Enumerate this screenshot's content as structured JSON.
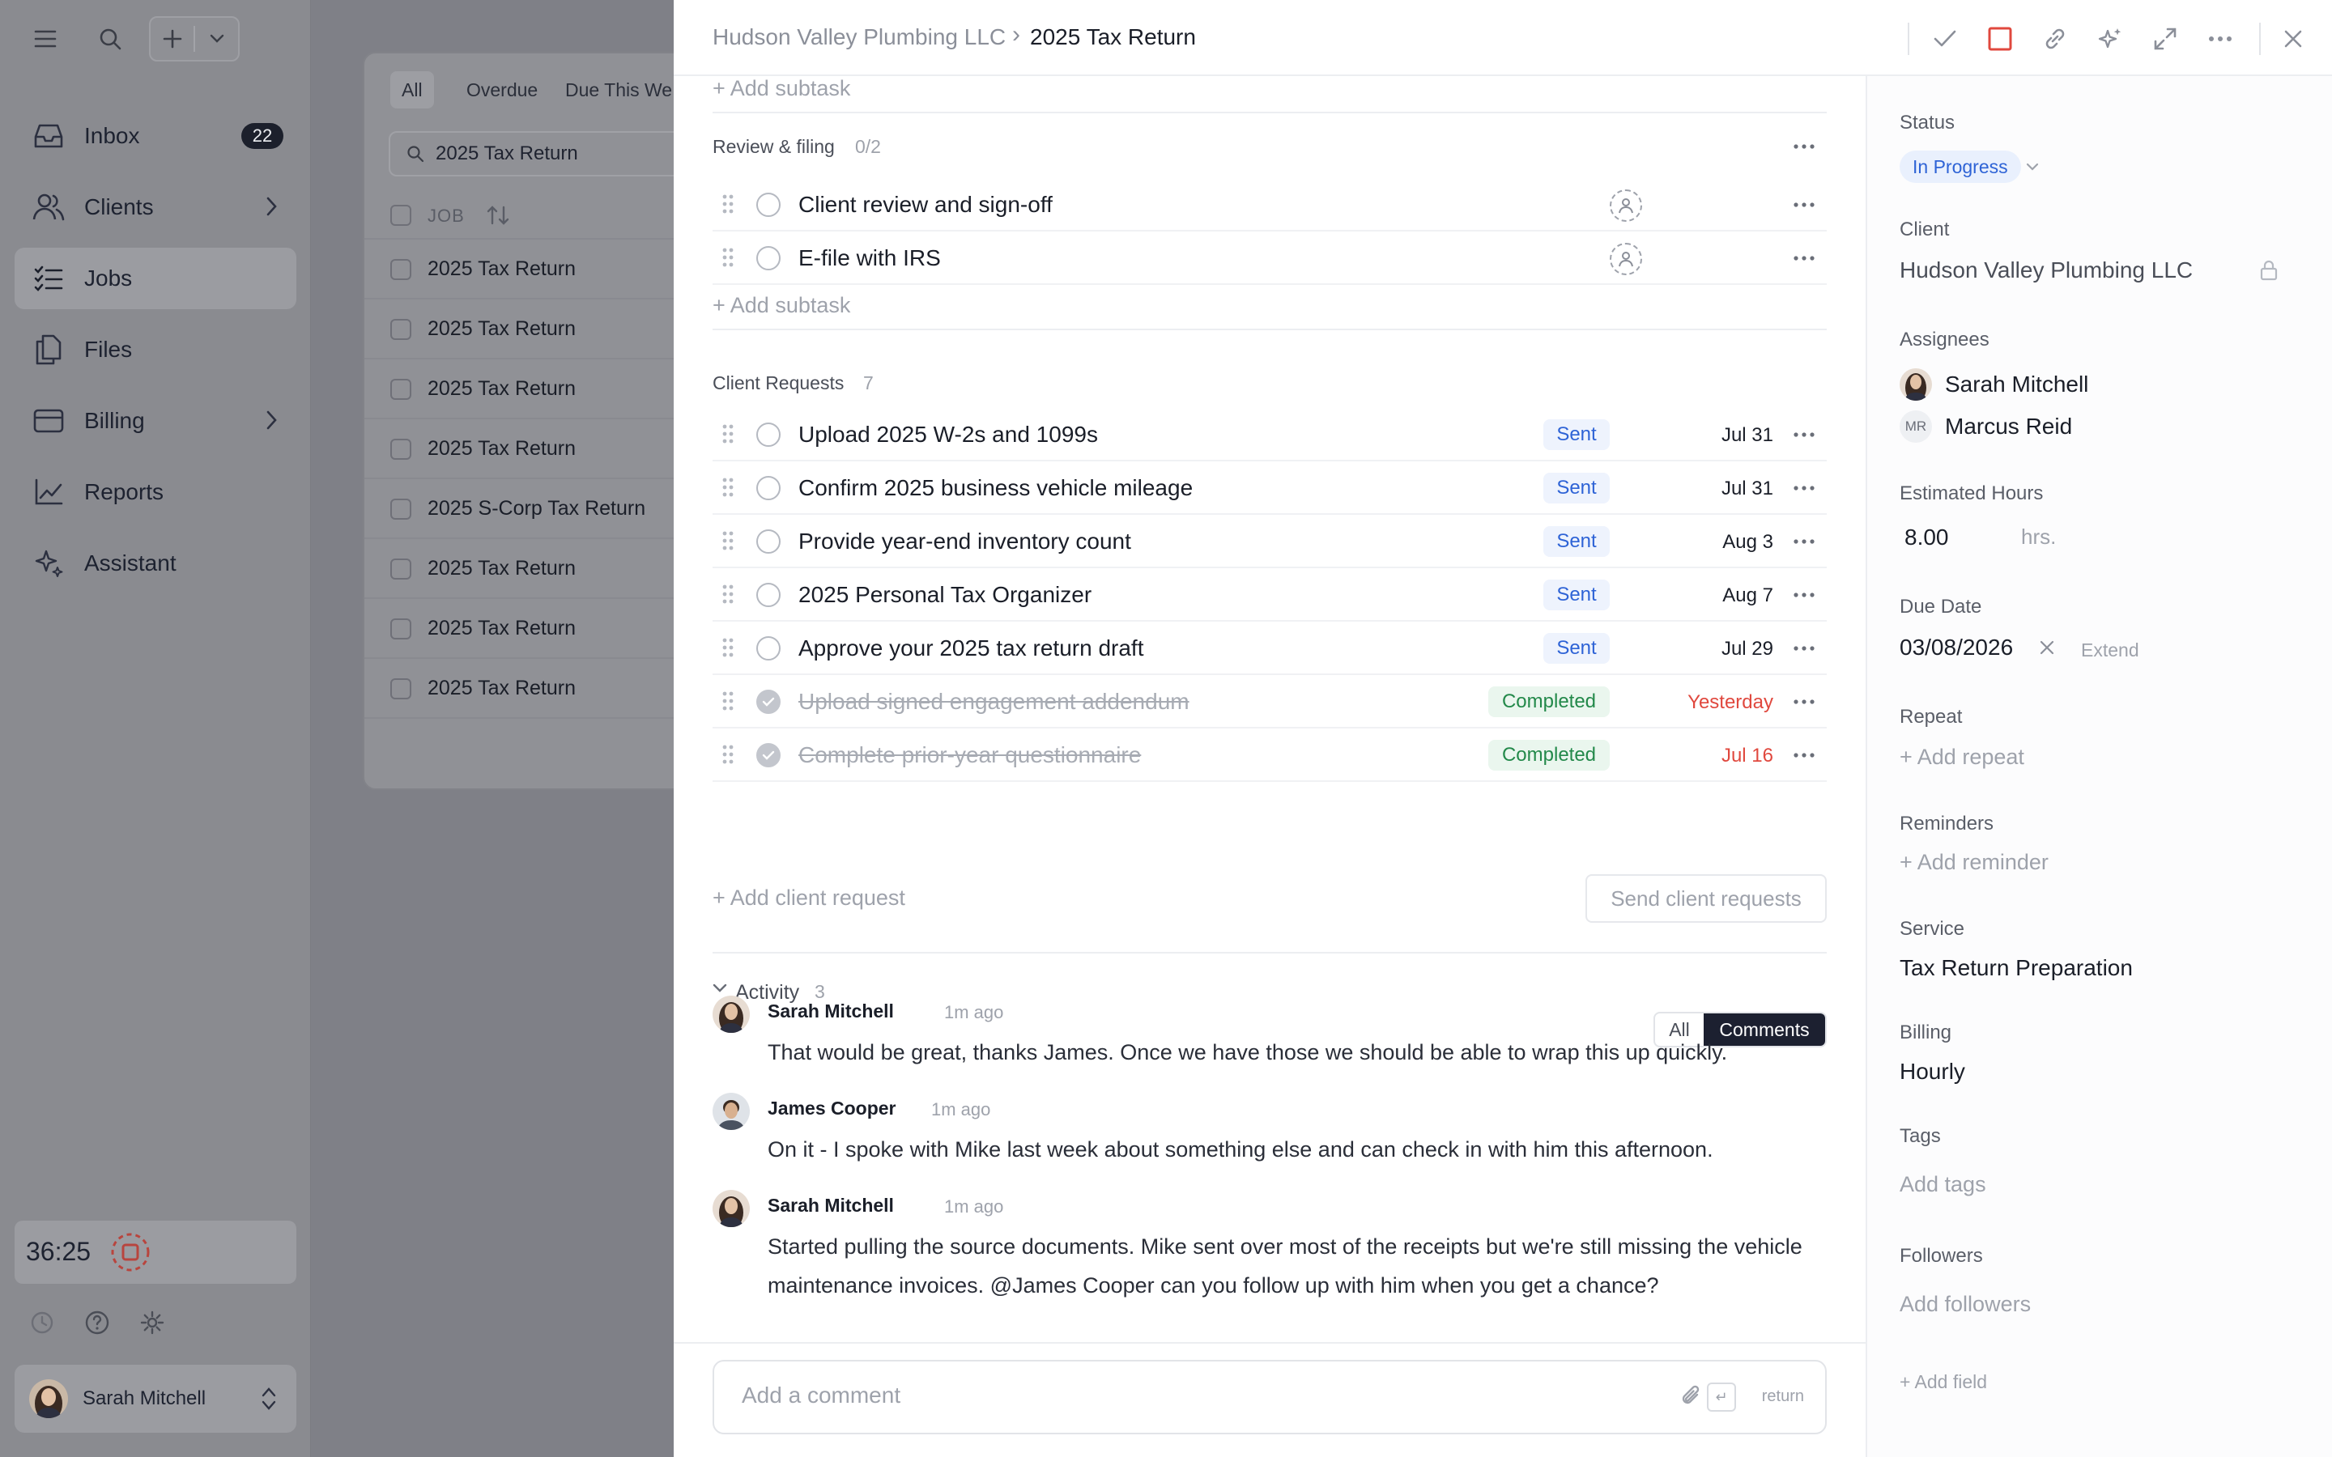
{
  "sidebar": {
    "nav": [
      {
        "label": "Inbox",
        "badge": "22",
        "icon": "inbox-icon"
      },
      {
        "label": "Clients",
        "icon": "users-icon"
      },
      {
        "label": "Jobs",
        "icon": "checklist-icon"
      },
      {
        "label": "Files",
        "icon": "files-icon"
      },
      {
        "label": "Billing",
        "icon": "card-icon"
      },
      {
        "label": "Reports",
        "icon": "chart-icon"
      },
      {
        "label": "Assistant",
        "icon": "sparkle-icon"
      }
    ],
    "timer": "36:25",
    "user": "Sarah Mitchell"
  },
  "jobs_list": {
    "filters": [
      "All",
      "Overdue",
      "Due This We"
    ],
    "search_value": "2025 Tax Return",
    "column": "JOB",
    "rows": [
      "2025 Tax Return",
      "2025 Tax Return",
      "2025 Tax Return",
      "2025 Tax Return",
      "2025 S-Corp Tax Return",
      "2025 Tax Return",
      "2025 Tax Return",
      "2025 Tax Return"
    ]
  },
  "breadcrumb": {
    "client": "Hudson Valley Plumbing LLC",
    "separator": "›",
    "job": "2025 Tax Return"
  },
  "add_subtask": "+ Add subtask",
  "review": {
    "title": "Review & filing",
    "count": "0/2",
    "items": [
      "Client review and sign-off",
      "E-file with IRS"
    ]
  },
  "requests": {
    "title": "Client Requests",
    "count": "7",
    "items": [
      {
        "title": "Upload 2025 W-2s and 1099s",
        "status": "Sent",
        "date": "Jul 31"
      },
      {
        "title": "Confirm 2025 business vehicle mileage",
        "status": "Sent",
        "date": "Jul 31"
      },
      {
        "title": "Provide year-end inventory count",
        "status": "Sent",
        "date": "Aug 3"
      },
      {
        "title": "2025 Personal Tax Organizer",
        "status": "Sent",
        "date": "Aug 7"
      },
      {
        "title": "Approve your 2025 tax return draft",
        "status": "Sent",
        "date": "Jul 29"
      },
      {
        "title": "Upload signed engagement addendum",
        "status": "Completed",
        "date": "Yesterday"
      },
      {
        "title": "Complete prior-year questionnaire",
        "status": "Completed",
        "date": "Jul 16"
      }
    ],
    "add_label": "+ Add client request",
    "send_label": "Send client requests"
  },
  "activity": {
    "title": "Activity",
    "count": "3",
    "tabs": [
      "All",
      "Comments"
    ],
    "comments": [
      {
        "author": "Sarah Mitchell",
        "time": "1m ago",
        "text": "That would be great, thanks James. Once we have those we should be able to wrap this up quickly."
      },
      {
        "author": "James Cooper",
        "time": "1m ago",
        "text": "On it - I spoke with Mike last week about something else and can check in with him this afternoon."
      },
      {
        "author": "Sarah Mitchell",
        "time": "1m ago",
        "text": "Started pulling the source documents. Mike sent over most of the receipts but we're still missing the vehicle maintenance invoices. @James Cooper can you follow up with him when you get a chance?"
      }
    ]
  },
  "composer": {
    "placeholder": "Add a comment",
    "enter_hint": "↵",
    "return_label": "return"
  },
  "properties": {
    "status_label": "Status",
    "status": "In Progress",
    "client_label": "Client",
    "client": "Hudson Valley Plumbing LLC",
    "assignees_label": "Assignees",
    "assignees": [
      {
        "name": "Sarah Mitchell"
      },
      {
        "name": "Marcus Reid",
        "initials": "MR"
      }
    ],
    "hours_label": "Estimated Hours",
    "hours": "8.00",
    "hours_unit": "hrs.",
    "due_label": "Due Date",
    "due": "03/08/2026",
    "extend": "Extend",
    "repeat_label": "Repeat",
    "repeat_add": "+ Add repeat",
    "reminders_label": "Reminders",
    "reminders_add": "+ Add reminder",
    "service_label": "Service",
    "service": "Tax Return Preparation",
    "billing_label": "Billing",
    "billing": "Hourly",
    "tags_label": "Tags",
    "tags_add": "Add tags",
    "followers_label": "Followers",
    "followers_add": "Add followers",
    "add_field": "+ Add field"
  },
  "colors": {
    "accent_blue": "#2e63d6",
    "sent_bg": "#eef3fd",
    "completed_green": "#23894a",
    "overdue_red": "#e0483e",
    "stop_red": "#e0483e"
  }
}
